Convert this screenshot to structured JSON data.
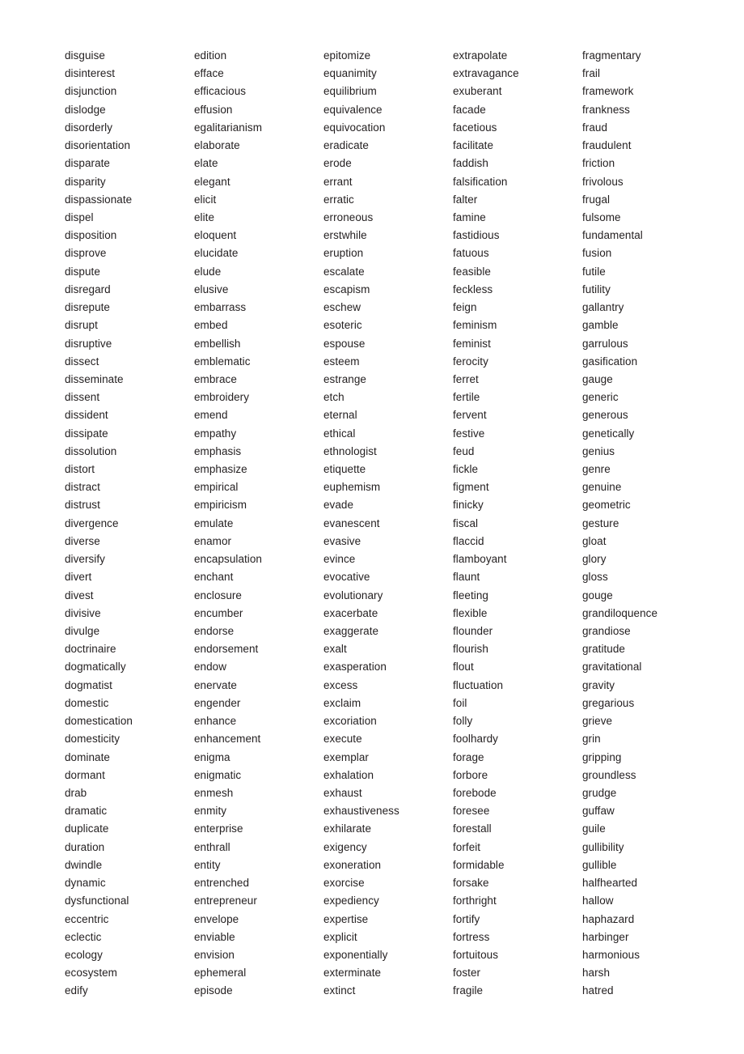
{
  "page": {
    "type": "vocabulary-word-list",
    "background_color": "#ffffff",
    "text_color": "#231f20",
    "column_count": 5,
    "rows_per_column": 53
  },
  "columns": [
    {
      "id": "column-1",
      "words": [
        "disguise",
        "disinterest",
        "disjunction",
        "dislodge",
        "disorderly",
        "disorientation",
        "disparate",
        "disparity",
        "dispassionate",
        "dispel",
        "disposition",
        "disprove",
        "dispute",
        "disregard",
        "disrepute",
        "disrupt",
        "disruptive",
        "dissect",
        "disseminate",
        "dissent",
        "dissident",
        "dissipate",
        "dissolution",
        "distort",
        "distract",
        "distrust",
        "divergence",
        "diverse",
        "diversify",
        "divert",
        "divest",
        "divisive",
        "divulge",
        "doctrinaire",
        "dogmatically",
        "dogmatist",
        "domestic",
        "domestication",
        "domesticity",
        "dominate",
        "dormant",
        "drab",
        "dramatic",
        "duplicate",
        "duration",
        "dwindle",
        "dynamic",
        "dysfunctional",
        "eccentric",
        "eclectic",
        "ecology",
        "ecosystem",
        "edify"
      ]
    },
    {
      "id": "column-2",
      "words": [
        "edition",
        "efface",
        "efficacious",
        "effusion",
        "egalitarianism",
        "elaborate",
        "elate",
        "elegant",
        "elicit",
        "elite",
        "eloquent",
        "elucidate",
        "elude",
        "elusive",
        "embarrass",
        "embed",
        "embellish",
        "emblematic",
        "embrace",
        "embroidery",
        "emend",
        "empathy",
        "emphasis",
        "emphasize",
        "empirical",
        "empiricism",
        "emulate",
        "enamor",
        "encapsulation",
        "enchant",
        "enclosure",
        "encumber",
        "endorse",
        "endorsement",
        "endow",
        "enervate",
        "engender",
        "enhance",
        "enhancement",
        "enigma",
        "enigmatic",
        "enmesh",
        "enmity",
        "enterprise",
        "enthrall",
        "entity",
        "entrenched",
        "entrepreneur",
        "envelope",
        "enviable",
        "envision",
        "ephemeral",
        "episode"
      ]
    },
    {
      "id": "column-3",
      "words": [
        "epitomize",
        "equanimity",
        "equilibrium",
        "equivalence",
        "equivocation",
        "eradicate",
        "erode",
        "errant",
        "erratic",
        "erroneous",
        "erstwhile",
        "eruption",
        "escalate",
        "escapism",
        "eschew",
        "esoteric",
        "espouse",
        "esteem",
        "estrange",
        "etch",
        "eternal",
        "ethical",
        "ethnologist",
        "etiquette",
        "euphemism",
        "evade",
        "evanescent",
        "evasive",
        "evince",
        "evocative",
        "evolutionary",
        "exacerbate",
        "exaggerate",
        "exalt",
        "exasperation",
        "excess",
        "exclaim",
        "excoriation",
        "execute",
        "exemplar",
        "exhalation",
        "exhaust",
        "exhaustiveness",
        "exhilarate",
        "exigency",
        "exoneration",
        "exorcise",
        "expediency",
        "expertise",
        "explicit",
        "exponentially",
        "exterminate",
        "extinct"
      ]
    },
    {
      "id": "column-4",
      "words": [
        "extrapolate",
        "extravagance",
        "exuberant",
        "facade",
        "facetious",
        "facilitate",
        "faddish",
        "falsification",
        "falter",
        "famine",
        "fastidious",
        "fatuous",
        "feasible",
        "feckless",
        "feign",
        "feminism",
        "feminist",
        "ferocity",
        "ferret",
        "fertile",
        "fervent",
        "festive",
        "feud",
        "fickle",
        "figment",
        "finicky",
        "fiscal",
        "flaccid",
        "flamboyant",
        "flaunt",
        "fleeting",
        "flexible",
        "flounder",
        "flourish",
        "flout",
        "fluctuation",
        "foil",
        "folly",
        "foolhardy",
        "forage",
        "forbore",
        "forebode",
        "foresee",
        "forestall",
        "forfeit",
        "formidable",
        "forsake",
        "forthright",
        "fortify",
        "fortress",
        "fortuitous",
        "foster",
        "fragile"
      ]
    },
    {
      "id": "column-5",
      "words": [
        "fragmentary",
        "frail",
        "framework",
        "frankness",
        "fraud",
        "fraudulent",
        "friction",
        "frivolous",
        "frugal",
        "fulsome",
        "fundamental",
        "fusion",
        "futile",
        "futility",
        "gallantry",
        "gamble",
        "garrulous",
        "gasification",
        "gauge",
        "generic",
        "generous",
        "genetically",
        "genius",
        "genre",
        "genuine",
        "geometric",
        "gesture",
        "gloat",
        "glory",
        "gloss",
        "gouge",
        "grandiloquence",
        "grandiose",
        "gratitude",
        "gravitational",
        "gravity",
        "gregarious",
        "grieve",
        "grin",
        "gripping",
        "groundless",
        "grudge",
        "guffaw",
        "guile",
        "gullibility",
        "gullible",
        "halfhearted",
        "hallow",
        "haphazard",
        "harbinger",
        "harmonious",
        "harsh",
        "hatred"
      ]
    }
  ]
}
